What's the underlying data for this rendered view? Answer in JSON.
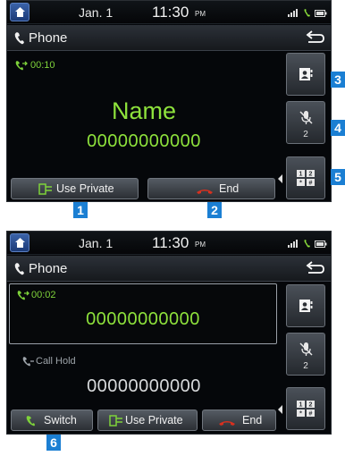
{
  "status": {
    "date": "Jan.  1",
    "time": "11:30",
    "ampm": "PM"
  },
  "titlebar": {
    "title": "Phone"
  },
  "screen1": {
    "timer": "00:10",
    "caller_name": "Name",
    "caller_number": "00000000000",
    "buttons": {
      "use_private": "Use Private",
      "end": "End"
    },
    "side": {
      "mic_count": "2"
    }
  },
  "screen2": {
    "active_timer": "00:02",
    "active_number": "00000000000",
    "hold_label": "Call Hold",
    "hold_number": "00000000000",
    "buttons": {
      "switch": "Switch",
      "use_private": "Use Private",
      "end": "End"
    },
    "side": {
      "mic_count": "2"
    }
  },
  "callouts": [
    "1",
    "2",
    "3",
    "4",
    "5",
    "6"
  ],
  "colors": {
    "accent_green": "#8ee23c",
    "callout_blue": "#1b7fd3",
    "end_red": "#d8301f"
  }
}
